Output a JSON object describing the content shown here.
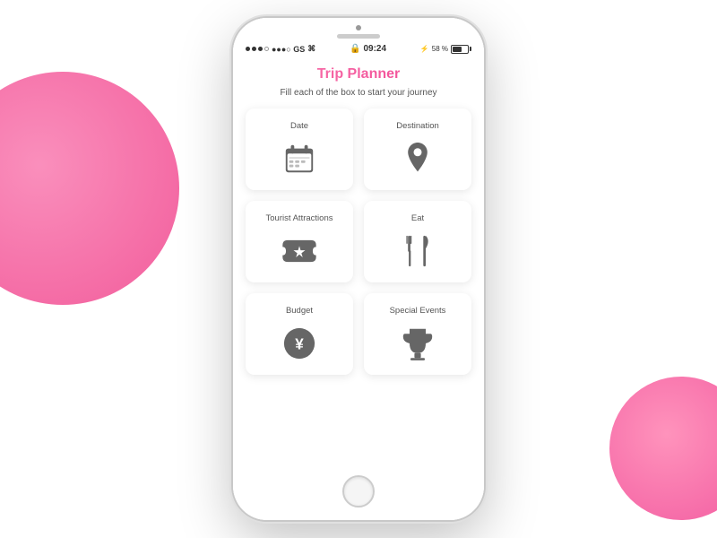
{
  "background": {
    "circle_left": "gradient pink",
    "circle_right": "gradient pink small"
  },
  "status_bar": {
    "carrier": "●●●○ GS",
    "wifi": "WiFi",
    "time": "09:24",
    "battery_percent": "58 %"
  },
  "app": {
    "title": "Trip Planner",
    "subtitle": "Fill each of the box to start your journey"
  },
  "cards": [
    {
      "id": "date",
      "label": "Date",
      "icon": "calendar-icon"
    },
    {
      "id": "destination",
      "label": "Destination",
      "icon": "location-icon"
    },
    {
      "id": "tourist-attractions",
      "label": "Tourist Attractions",
      "icon": "ticket-icon"
    },
    {
      "id": "eat",
      "label": "Eat",
      "icon": "food-icon"
    },
    {
      "id": "budget",
      "label": "Budget",
      "icon": "currency-icon"
    },
    {
      "id": "special-events",
      "label": "Special Events",
      "icon": "trophy-icon"
    }
  ]
}
